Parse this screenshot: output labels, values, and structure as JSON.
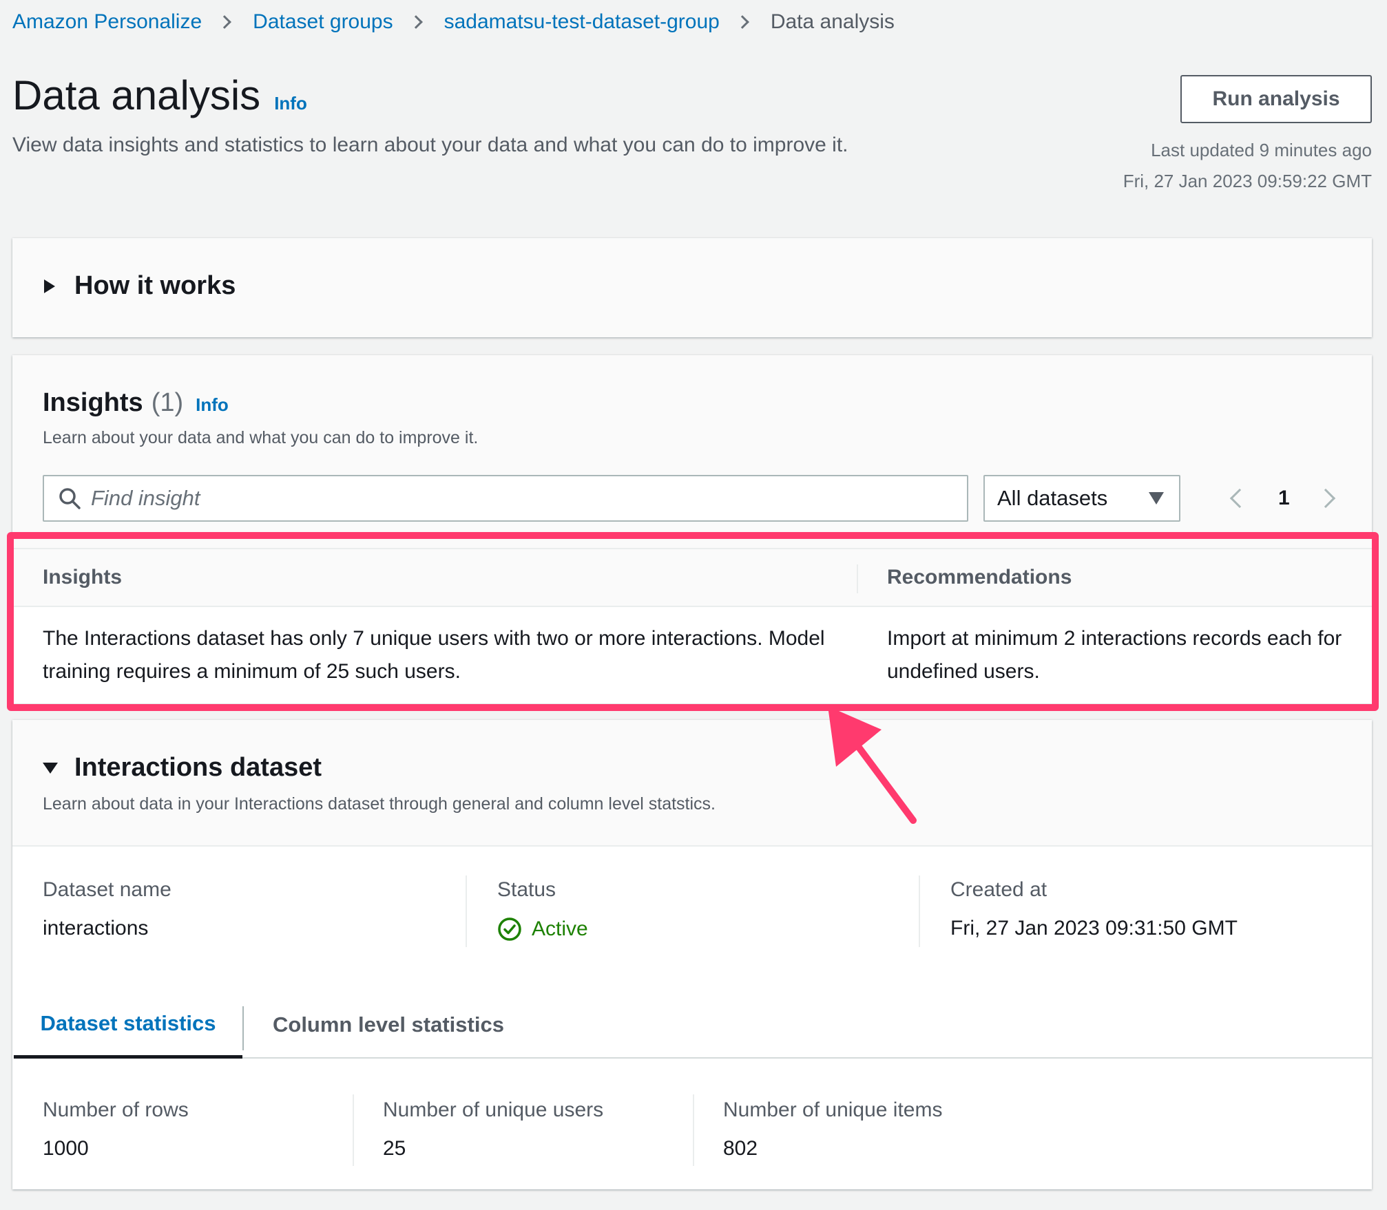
{
  "breadcrumb": {
    "items": [
      "Amazon Personalize",
      "Dataset groups",
      "sadamatsu-test-dataset-group"
    ],
    "current": "Data analysis"
  },
  "header": {
    "title": "Data analysis",
    "info": "Info",
    "description": "View data insights and statistics to learn about your data and what you can do to improve it.",
    "run_button": "Run analysis",
    "last_updated": "Last updated 9 minutes ago",
    "last_updated_date": "Fri, 27 Jan 2023 09:59:22 GMT"
  },
  "how_it_works": {
    "title": "How it works"
  },
  "insights": {
    "title": "Insights",
    "count": "(1)",
    "info": "Info",
    "description": "Learn about your data and what you can do to improve it.",
    "search_placeholder": "Find insight",
    "filter_value": "All datasets",
    "page": "1",
    "columns": [
      "Insights",
      "Recommendations"
    ],
    "rows": [
      {
        "insight": "The Interactions dataset has only 7 unique users with two or more interactions. Model training requires a minimum of 25 such users.",
        "recommendation": "Import at minimum 2 interactions records each for undefined users."
      }
    ]
  },
  "interactions": {
    "title": "Interactions dataset",
    "description": "Learn about data in your Interactions dataset through general and column level statstics.",
    "dataset_name_label": "Dataset name",
    "dataset_name": "interactions",
    "status_label": "Status",
    "status": "Active",
    "created_label": "Created at",
    "created": "Fri, 27 Jan 2023 09:31:50 GMT",
    "tabs": [
      "Dataset statistics",
      "Column level statistics"
    ],
    "stats": [
      {
        "label": "Number of rows",
        "value": "1000"
      },
      {
        "label": "Number of unique users",
        "value": "25"
      },
      {
        "label": "Number of unique items",
        "value": "802"
      }
    ]
  },
  "colors": {
    "link": "#0073bb",
    "highlight": "#ff3a6e",
    "status_active": "#1d8102",
    "background": "#f2f3f3"
  },
  "icons": [
    "chevron-right-icon",
    "caret-right-icon",
    "caret-down-icon",
    "search-icon",
    "chevron-left-icon",
    "status-success-icon"
  ]
}
